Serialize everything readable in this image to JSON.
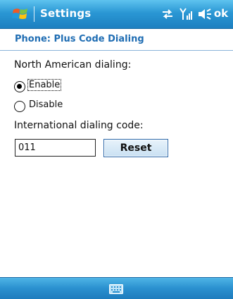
{
  "titlebar": {
    "title": "Settings",
    "ok_label": "ok",
    "icons": [
      "windows-start-icon",
      "connectivity-icon",
      "signal-icon",
      "speaker-icon"
    ]
  },
  "page": {
    "title": "Phone: Plus Code Dialing"
  },
  "form": {
    "north_american_label": "North American dialing:",
    "options": [
      {
        "label": "Enable",
        "selected": true
      },
      {
        "label": "Disable",
        "selected": false
      }
    ],
    "intl_code_label": "International dialing code:",
    "intl_code_value": "011",
    "reset_label": "Reset"
  },
  "menubar": {
    "icon": "keyboard-icon"
  },
  "colors": {
    "titlebar": "#2a97d4",
    "page_title": "#1f6db3",
    "menubar": "#2a90cf"
  }
}
